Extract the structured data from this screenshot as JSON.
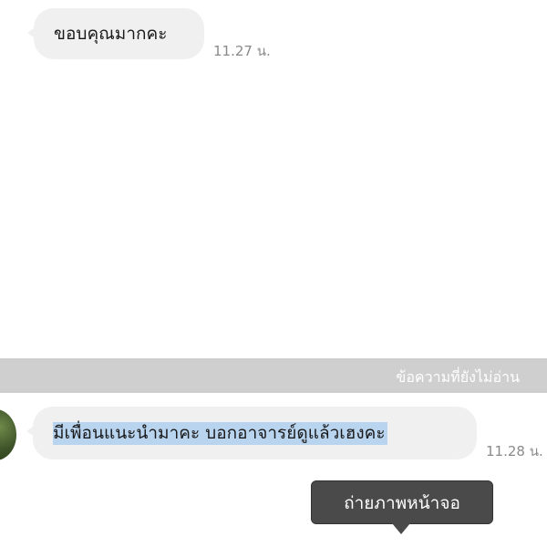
{
  "messages": [
    {
      "text": "ขอบคุณมากคะ",
      "time": "11.27 น."
    },
    {
      "text": "มีเพื่อนแนะนำมาคะ  บอกอาจารย์ดูแล้วเฮงคะ",
      "time": "11.28 น."
    }
  ],
  "divider": {
    "label": "ข้อความที่ยังไม่อ่าน"
  },
  "context_menu": {
    "screenshot_label": "ถ่ายภาพหน้าจอ"
  }
}
